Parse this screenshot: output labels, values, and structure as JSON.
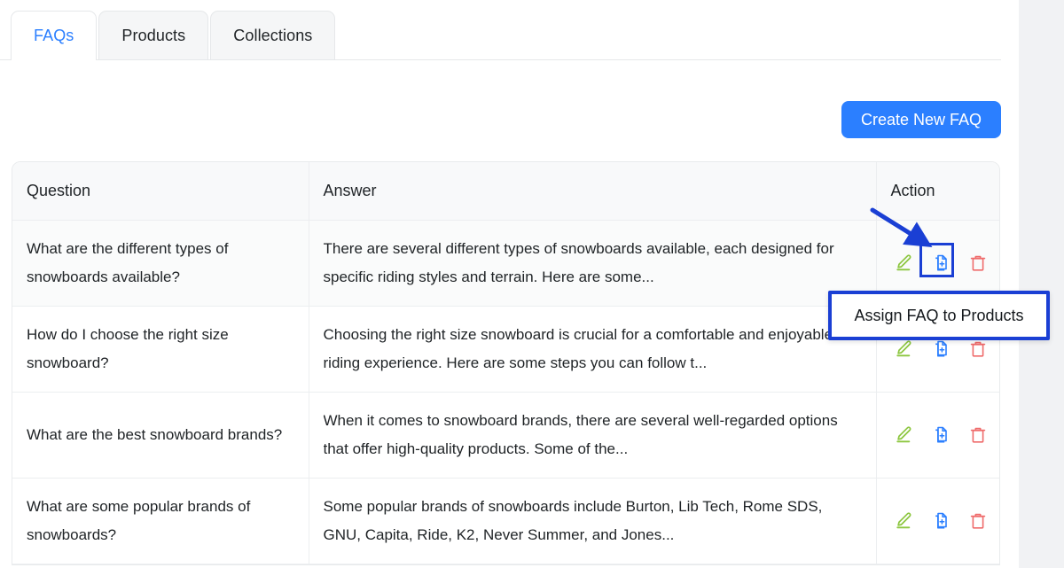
{
  "colors": {
    "accent_blue": "#2b7fff",
    "annotation_blue": "#1a3fd4",
    "edit_green": "#8cc63f",
    "assign_blue": "#2b7fff",
    "delete_red": "#ef6b6b",
    "page_bg": "#f1f2f4",
    "header_bg": "#f8f9fa"
  },
  "tabs": [
    {
      "label": "FAQs",
      "active": true
    },
    {
      "label": "Products",
      "active": false
    },
    {
      "label": "Collections",
      "active": false
    }
  ],
  "toolbar": {
    "create_label": "Create New FAQ"
  },
  "table": {
    "columns": [
      "Question",
      "Answer",
      "Action"
    ],
    "rows": [
      {
        "question": "What are the different types of snowboards available?",
        "answer": "There are several different types of snowboards available, each designed for specific riding styles and terrain. Here are some...",
        "actions": [
          "edit-icon",
          "assign-icon",
          "delete-icon"
        ]
      },
      {
        "question": "How do I choose the right size snowboard?",
        "answer": "Choosing the right size snowboard is crucial for a comfortable and enjoyable riding experience. Here are some steps you can follow t...",
        "actions": [
          "edit-icon",
          "assign-icon",
          "delete-icon"
        ]
      },
      {
        "question": "What are the best snowboard brands?",
        "answer": "When it comes to snowboard brands, there are several well-regarded options that offer high-quality products. Some of the...",
        "actions": [
          "edit-icon",
          "assign-icon",
          "delete-icon"
        ]
      },
      {
        "question": "What are some popular brands of snowboards?",
        "answer": "Some popular brands of snowboards include Burton, Lib Tech, Rome SDS, GNU, Capita, Ride, K2, Never Summer, and Jones...",
        "actions": [
          "edit-icon",
          "assign-icon",
          "delete-icon"
        ]
      }
    ]
  },
  "annotation": {
    "tooltip_label": "Assign FAQ to Products"
  }
}
